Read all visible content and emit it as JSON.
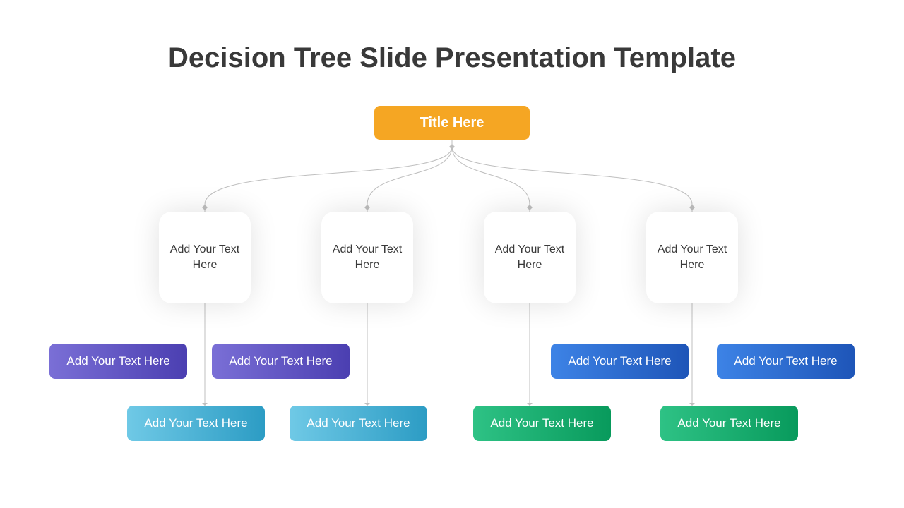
{
  "title": "Decision Tree Slide Presentation Template",
  "root": {
    "label": "Title Here"
  },
  "mids": [
    {
      "label": "Add Your Text Here"
    },
    {
      "label": "Add Your Text Here"
    },
    {
      "label": "Add Your Text Here"
    },
    {
      "label": "Add Your Text Here"
    }
  ],
  "leaves": {
    "col1_top": "Add Your Text Here",
    "col1_bottom": "Add Your Text Here",
    "col2_top": "Add Your Text Here",
    "col2_bottom": "Add Your Text Here",
    "col3_top": "Add Your Text Here",
    "col3_bottom": "Add Your Text Here",
    "col4_top": "Add Your Text Here",
    "col4_bottom": "Add Your Text Here"
  },
  "colors": {
    "root": "#f5a623",
    "purple": "#5a4ec0",
    "cyan": "#4ab3d5",
    "blue": "#2965cf",
    "green": "#17ad6f"
  }
}
